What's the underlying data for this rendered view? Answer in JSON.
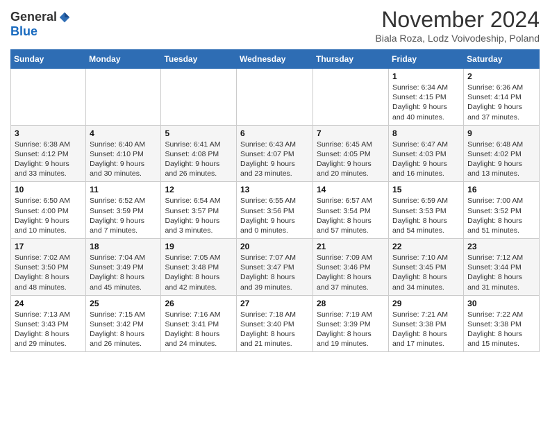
{
  "header": {
    "logo_general": "General",
    "logo_blue": "Blue",
    "month_title": "November 2024",
    "subtitle": "Biala Roza, Lodz Voivodeship, Poland"
  },
  "weekdays": [
    "Sunday",
    "Monday",
    "Tuesday",
    "Wednesday",
    "Thursday",
    "Friday",
    "Saturday"
  ],
  "weeks": [
    [
      {
        "day": "",
        "sunrise": "",
        "sunset": "",
        "daylight": ""
      },
      {
        "day": "",
        "sunrise": "",
        "sunset": "",
        "daylight": ""
      },
      {
        "day": "",
        "sunrise": "",
        "sunset": "",
        "daylight": ""
      },
      {
        "day": "",
        "sunrise": "",
        "sunset": "",
        "daylight": ""
      },
      {
        "day": "",
        "sunrise": "",
        "sunset": "",
        "daylight": ""
      },
      {
        "day": "1",
        "sunrise": "Sunrise: 6:34 AM",
        "sunset": "Sunset: 4:15 PM",
        "daylight": "Daylight: 9 hours and 40 minutes."
      },
      {
        "day": "2",
        "sunrise": "Sunrise: 6:36 AM",
        "sunset": "Sunset: 4:14 PM",
        "daylight": "Daylight: 9 hours and 37 minutes."
      }
    ],
    [
      {
        "day": "3",
        "sunrise": "Sunrise: 6:38 AM",
        "sunset": "Sunset: 4:12 PM",
        "daylight": "Daylight: 9 hours and 33 minutes."
      },
      {
        "day": "4",
        "sunrise": "Sunrise: 6:40 AM",
        "sunset": "Sunset: 4:10 PM",
        "daylight": "Daylight: 9 hours and 30 minutes."
      },
      {
        "day": "5",
        "sunrise": "Sunrise: 6:41 AM",
        "sunset": "Sunset: 4:08 PM",
        "daylight": "Daylight: 9 hours and 26 minutes."
      },
      {
        "day": "6",
        "sunrise": "Sunrise: 6:43 AM",
        "sunset": "Sunset: 4:07 PM",
        "daylight": "Daylight: 9 hours and 23 minutes."
      },
      {
        "day": "7",
        "sunrise": "Sunrise: 6:45 AM",
        "sunset": "Sunset: 4:05 PM",
        "daylight": "Daylight: 9 hours and 20 minutes."
      },
      {
        "day": "8",
        "sunrise": "Sunrise: 6:47 AM",
        "sunset": "Sunset: 4:03 PM",
        "daylight": "Daylight: 9 hours and 16 minutes."
      },
      {
        "day": "9",
        "sunrise": "Sunrise: 6:48 AM",
        "sunset": "Sunset: 4:02 PM",
        "daylight": "Daylight: 9 hours and 13 minutes."
      }
    ],
    [
      {
        "day": "10",
        "sunrise": "Sunrise: 6:50 AM",
        "sunset": "Sunset: 4:00 PM",
        "daylight": "Daylight: 9 hours and 10 minutes."
      },
      {
        "day": "11",
        "sunrise": "Sunrise: 6:52 AM",
        "sunset": "Sunset: 3:59 PM",
        "daylight": "Daylight: 9 hours and 7 minutes."
      },
      {
        "day": "12",
        "sunrise": "Sunrise: 6:54 AM",
        "sunset": "Sunset: 3:57 PM",
        "daylight": "Daylight: 9 hours and 3 minutes."
      },
      {
        "day": "13",
        "sunrise": "Sunrise: 6:55 AM",
        "sunset": "Sunset: 3:56 PM",
        "daylight": "Daylight: 9 hours and 0 minutes."
      },
      {
        "day": "14",
        "sunrise": "Sunrise: 6:57 AM",
        "sunset": "Sunset: 3:54 PM",
        "daylight": "Daylight: 8 hours and 57 minutes."
      },
      {
        "day": "15",
        "sunrise": "Sunrise: 6:59 AM",
        "sunset": "Sunset: 3:53 PM",
        "daylight": "Daylight: 8 hours and 54 minutes."
      },
      {
        "day": "16",
        "sunrise": "Sunrise: 7:00 AM",
        "sunset": "Sunset: 3:52 PM",
        "daylight": "Daylight: 8 hours and 51 minutes."
      }
    ],
    [
      {
        "day": "17",
        "sunrise": "Sunrise: 7:02 AM",
        "sunset": "Sunset: 3:50 PM",
        "daylight": "Daylight: 8 hours and 48 minutes."
      },
      {
        "day": "18",
        "sunrise": "Sunrise: 7:04 AM",
        "sunset": "Sunset: 3:49 PM",
        "daylight": "Daylight: 8 hours and 45 minutes."
      },
      {
        "day": "19",
        "sunrise": "Sunrise: 7:05 AM",
        "sunset": "Sunset: 3:48 PM",
        "daylight": "Daylight: 8 hours and 42 minutes."
      },
      {
        "day": "20",
        "sunrise": "Sunrise: 7:07 AM",
        "sunset": "Sunset: 3:47 PM",
        "daylight": "Daylight: 8 hours and 39 minutes."
      },
      {
        "day": "21",
        "sunrise": "Sunrise: 7:09 AM",
        "sunset": "Sunset: 3:46 PM",
        "daylight": "Daylight: 8 hours and 37 minutes."
      },
      {
        "day": "22",
        "sunrise": "Sunrise: 7:10 AM",
        "sunset": "Sunset: 3:45 PM",
        "daylight": "Daylight: 8 hours and 34 minutes."
      },
      {
        "day": "23",
        "sunrise": "Sunrise: 7:12 AM",
        "sunset": "Sunset: 3:44 PM",
        "daylight": "Daylight: 8 hours and 31 minutes."
      }
    ],
    [
      {
        "day": "24",
        "sunrise": "Sunrise: 7:13 AM",
        "sunset": "Sunset: 3:43 PM",
        "daylight": "Daylight: 8 hours and 29 minutes."
      },
      {
        "day": "25",
        "sunrise": "Sunrise: 7:15 AM",
        "sunset": "Sunset: 3:42 PM",
        "daylight": "Daylight: 8 hours and 26 minutes."
      },
      {
        "day": "26",
        "sunrise": "Sunrise: 7:16 AM",
        "sunset": "Sunset: 3:41 PM",
        "daylight": "Daylight: 8 hours and 24 minutes."
      },
      {
        "day": "27",
        "sunrise": "Sunrise: 7:18 AM",
        "sunset": "Sunset: 3:40 PM",
        "daylight": "Daylight: 8 hours and 21 minutes."
      },
      {
        "day": "28",
        "sunrise": "Sunrise: 7:19 AM",
        "sunset": "Sunset: 3:39 PM",
        "daylight": "Daylight: 8 hours and 19 minutes."
      },
      {
        "day": "29",
        "sunrise": "Sunrise: 7:21 AM",
        "sunset": "Sunset: 3:38 PM",
        "daylight": "Daylight: 8 hours and 17 minutes."
      },
      {
        "day": "30",
        "sunrise": "Sunrise: 7:22 AM",
        "sunset": "Sunset: 3:38 PM",
        "daylight": "Daylight: 8 hours and 15 minutes."
      }
    ]
  ]
}
